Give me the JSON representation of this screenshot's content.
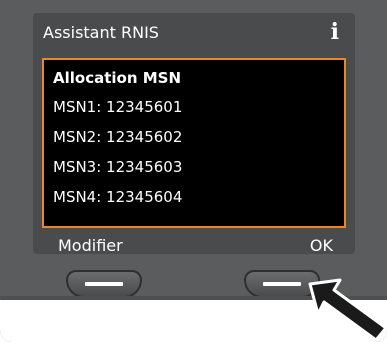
{
  "screen": {
    "title": "Assistant RNIS",
    "info_icon_glyph": "i",
    "content": {
      "heading": "Allocation MSN",
      "rows": [
        "MSN1: 12345601",
        "MSN2: 12345602",
        "MSN3: 12345603",
        "MSN4: 12345604"
      ]
    },
    "softkeys": {
      "left_label": "Modifier",
      "right_label": "OK"
    }
  },
  "colors": {
    "accent_border": "#e8872a",
    "device_body": "#5b5c5e",
    "content_bg": "#000000",
    "text": "#ffffff"
  },
  "icons": {
    "info": "info-icon",
    "pointer": "pointer-arrow-icon"
  }
}
